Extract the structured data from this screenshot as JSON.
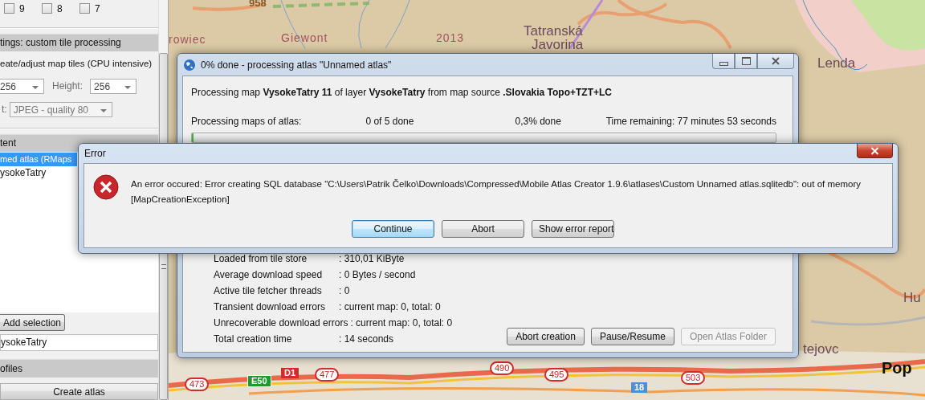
{
  "sidebar": {
    "zoom_levels": [
      {
        "label": "9",
        "checked": false
      },
      {
        "label": "8",
        "checked": false
      },
      {
        "label": "7",
        "checked": false
      }
    ],
    "tile_processing": {
      "header": "tings: custom tile processing",
      "option": "eate/adjust map tiles (CPU intensive)",
      "width_value": "256",
      "height_label": "Height:",
      "height_value": "256",
      "format_label": "t:",
      "format_value": "JPEG - quality 80",
      "format_disabled": true
    },
    "content": {
      "header": "tent",
      "tree": [
        {
          "label": "med atlas (RMaps",
          "selected": true,
          "children": [
            {
              "label": "ysokeTatry",
              "selected": false
            }
          ]
        }
      ],
      "add_button": "Add selection",
      "name_value": "ysokeTatry"
    },
    "profiles": {
      "header": "ofiles"
    },
    "create_button": "Create atlas"
  },
  "map": {
    "labels": [
      {
        "text": "958",
        "kind": "elevation"
      },
      {
        "text": "rowiec",
        "kind": "peak"
      },
      {
        "text": "Giewont",
        "kind": "peak"
      },
      {
        "text": "2013",
        "kind": "peak"
      },
      {
        "text": "Tatranská",
        "kind": "town"
      },
      {
        "text": "Javorina",
        "kind": "town"
      },
      {
        "text": "Lenda",
        "kind": "town"
      },
      {
        "text": "Hu",
        "kind": "town"
      },
      {
        "text": "tejovc",
        "kind": "town"
      },
      {
        "text": "Pop",
        "kind": "village"
      }
    ],
    "road_numbers": [
      {
        "label": "473",
        "kind": "national"
      },
      {
        "label": "E50",
        "kind": "european"
      },
      {
        "label": "D1",
        "kind": "motorway"
      },
      {
        "label": "477",
        "kind": "national"
      },
      {
        "label": "490",
        "kind": "national"
      },
      {
        "label": "495",
        "kind": "national"
      },
      {
        "label": "503",
        "kind": "national"
      },
      {
        "label": "18",
        "kind": "regional"
      }
    ]
  },
  "progress_window": {
    "title": "0% done - processing atlas \"Unnamed atlas\"",
    "status": "Processing map **VysokeTatry 11** of layer **VysokeTatry** from map source **.Slovakia Topo+TZT+LC**",
    "progress": {
      "label": "Processing maps of atlas:",
      "count": "0 of 5 done",
      "percent": "0,3% done",
      "remaining": "Time remaining: 77 minutes 53 seconds",
      "level": 0.003
    },
    "stats": [
      {
        "label": "Loaded from tile store",
        "value": ": 310,01 KiByte"
      },
      {
        "label": "Average download speed",
        "value": ": 0 Bytes / second"
      },
      {
        "label": "Active tile fetcher threads",
        "value": ": 0"
      },
      {
        "label": "Transient download errors",
        "value": ": current map: 0, total: 0"
      },
      {
        "label": "Unrecoverable download errors",
        "value": ": current map: 0, total: 0"
      },
      {
        "label": "Total creation time",
        "value": ": 14 seconds"
      }
    ],
    "buttons": [
      {
        "label": "Abort creation",
        "disabled": false
      },
      {
        "label": "Pause/Resume",
        "disabled": false
      },
      {
        "label": "Open Atlas Folder",
        "disabled": true
      }
    ]
  },
  "error_dialog": {
    "title": "Error",
    "message_lines": [
      "An error occured: Error creating SQL database \"C:\\Users\\Patrik Čelko\\Downloads\\Compressed\\Mobile Atlas Creator 1.9.6\\atlases\\Custom Unnamed atlas.sqlitedb\": out of memory",
      "[MapCreationException]"
    ],
    "buttons": [
      {
        "label": "Continue",
        "selected": true
      },
      {
        "label": "Abort",
        "selected": false
      },
      {
        "label": "Show error report",
        "selected": false
      }
    ]
  }
}
